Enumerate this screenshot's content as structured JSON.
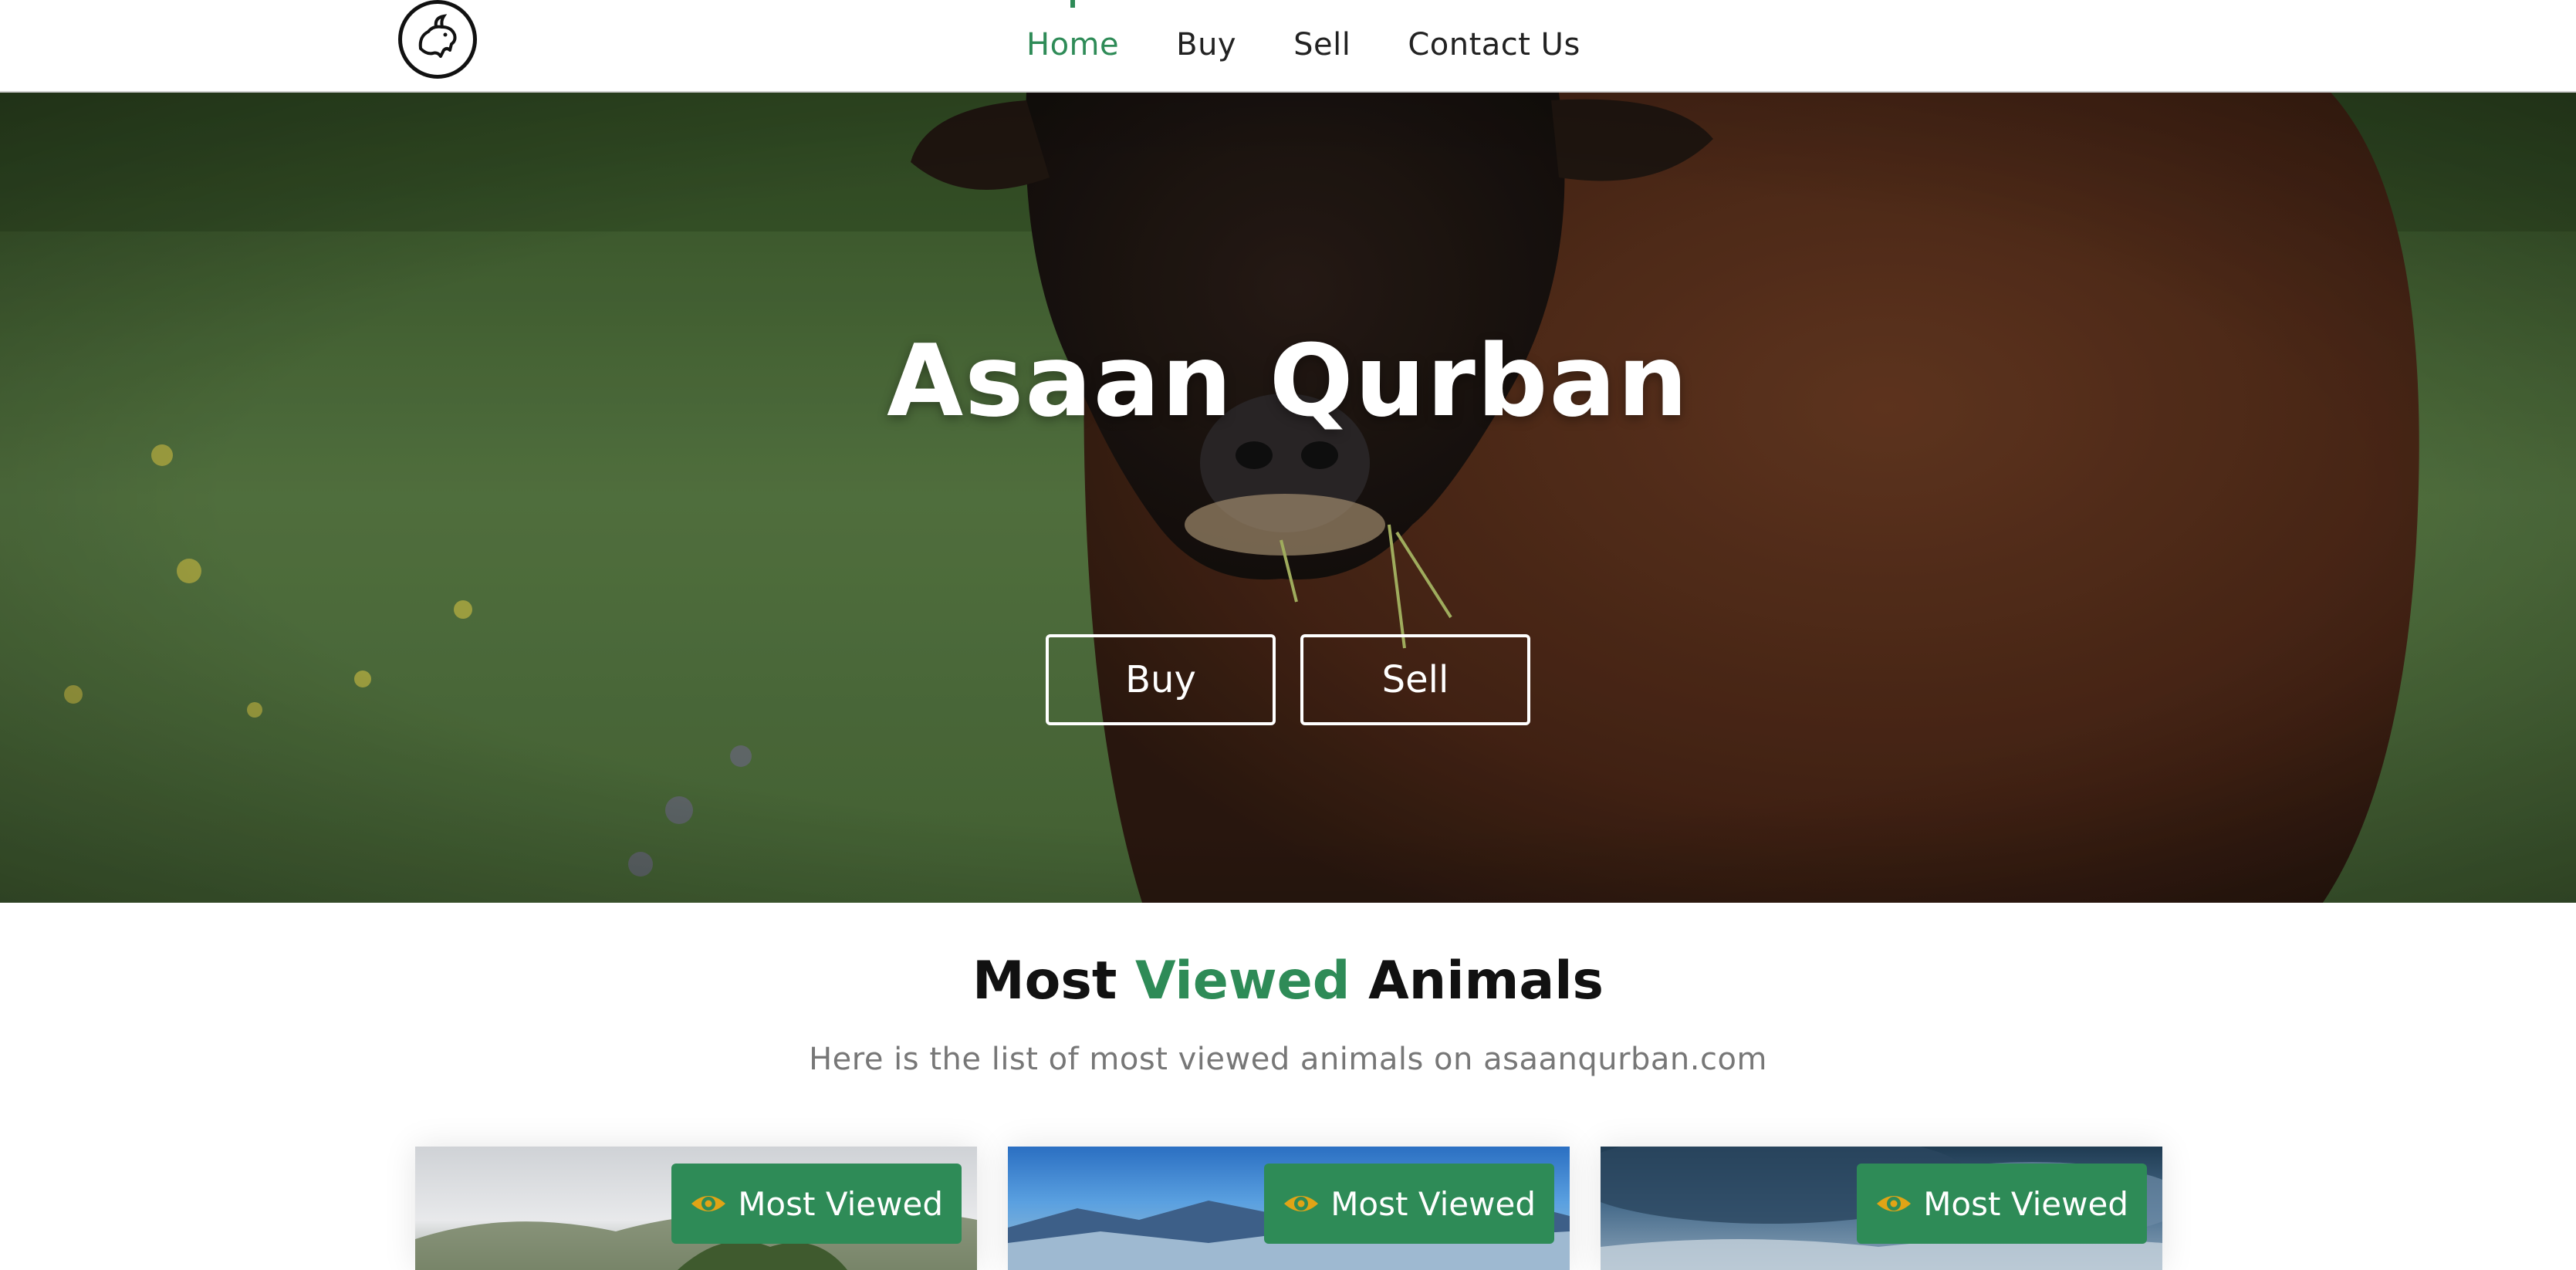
{
  "nav": {
    "links": [
      {
        "label": "Home",
        "active": true
      },
      {
        "label": "Buy"
      },
      {
        "label": "Sell"
      },
      {
        "label": "Contact Us"
      }
    ],
    "logo_icon": "goat-logo-icon"
  },
  "hero": {
    "title": "Asaan Qurban",
    "buy_label": "Buy",
    "sell_label": "Sell",
    "background": "cow-in-meadow-photo"
  },
  "section": {
    "title_before": "Most ",
    "title_accent": "Viewed",
    "title_after": " Animals",
    "subtitle": "Here is the list of most viewed animals on asaanqurban.com"
  },
  "cards": [
    {
      "badge": "Most Viewed",
      "badge_icon": "eye-icon"
    },
    {
      "badge": "Most Viewed",
      "badge_icon": "eye-icon"
    },
    {
      "badge": "Most Viewed",
      "badge_icon": "eye-icon"
    }
  ],
  "colors": {
    "accent": "#2e8b57",
    "eye_icon": "#e0a416",
    "text_dark": "#111111",
    "muted": "#777777"
  }
}
